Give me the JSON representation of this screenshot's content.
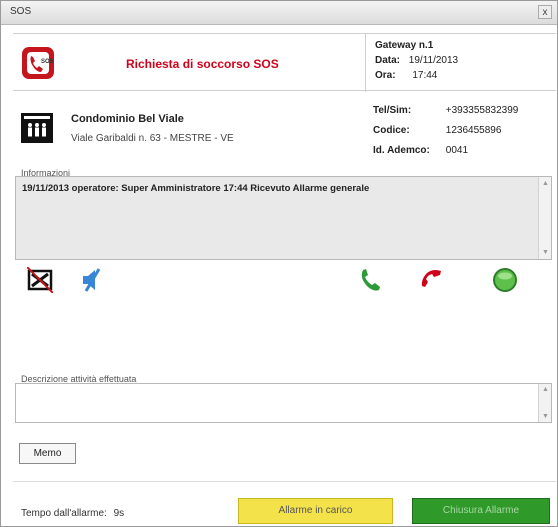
{
  "window": {
    "title": "SOS",
    "close_glyph": "x"
  },
  "header": {
    "title": "Richiesta di soccorso SOS",
    "icon": "sos-phone-icon",
    "gateway": "Gateway n.1",
    "date_label": "Data:",
    "date_value": "19/11/2013",
    "time_label": "Ora:",
    "time_value": "17:44"
  },
  "condominium": {
    "icon": "building-icon",
    "name": "Condominio Bel Viale",
    "address": "Viale Garibaldi n. 63 - MESTRE - VE",
    "tel_label": "Tel/Sim:",
    "tel_value": "+393355832399",
    "code_label": "Codice:",
    "code_value": "1236455896",
    "id_label": "Id. Ademco:",
    "id_value": "0041"
  },
  "info": {
    "label": "Informazioni",
    "text": "19/11/2013 operatore:  Super Amministratore 17:44 Ricevuto Allarme generale"
  },
  "actions": {
    "icons": [
      "no-video-icon",
      "mute-speaker-icon",
      "answer-call-icon",
      "hangup-call-icon",
      "green-status-button-icon"
    ],
    "colors": {
      "call_green": "#2e9a37",
      "hangup_red": "#d0021b",
      "speaker_blue": "#3a86d6"
    }
  },
  "description": {
    "label": "Descrizione attività effettuata",
    "value": ""
  },
  "memo_label": "Memo",
  "footer": {
    "elapsed_label": "Tempo dall'allarme:",
    "elapsed_value": "9s",
    "btn_carico": "Allarme in carico",
    "btn_chiusura": "Chiusura Allarme",
    "colors": {
      "carico": "#f4e24a",
      "chiusura": "#2f9a2a"
    }
  }
}
